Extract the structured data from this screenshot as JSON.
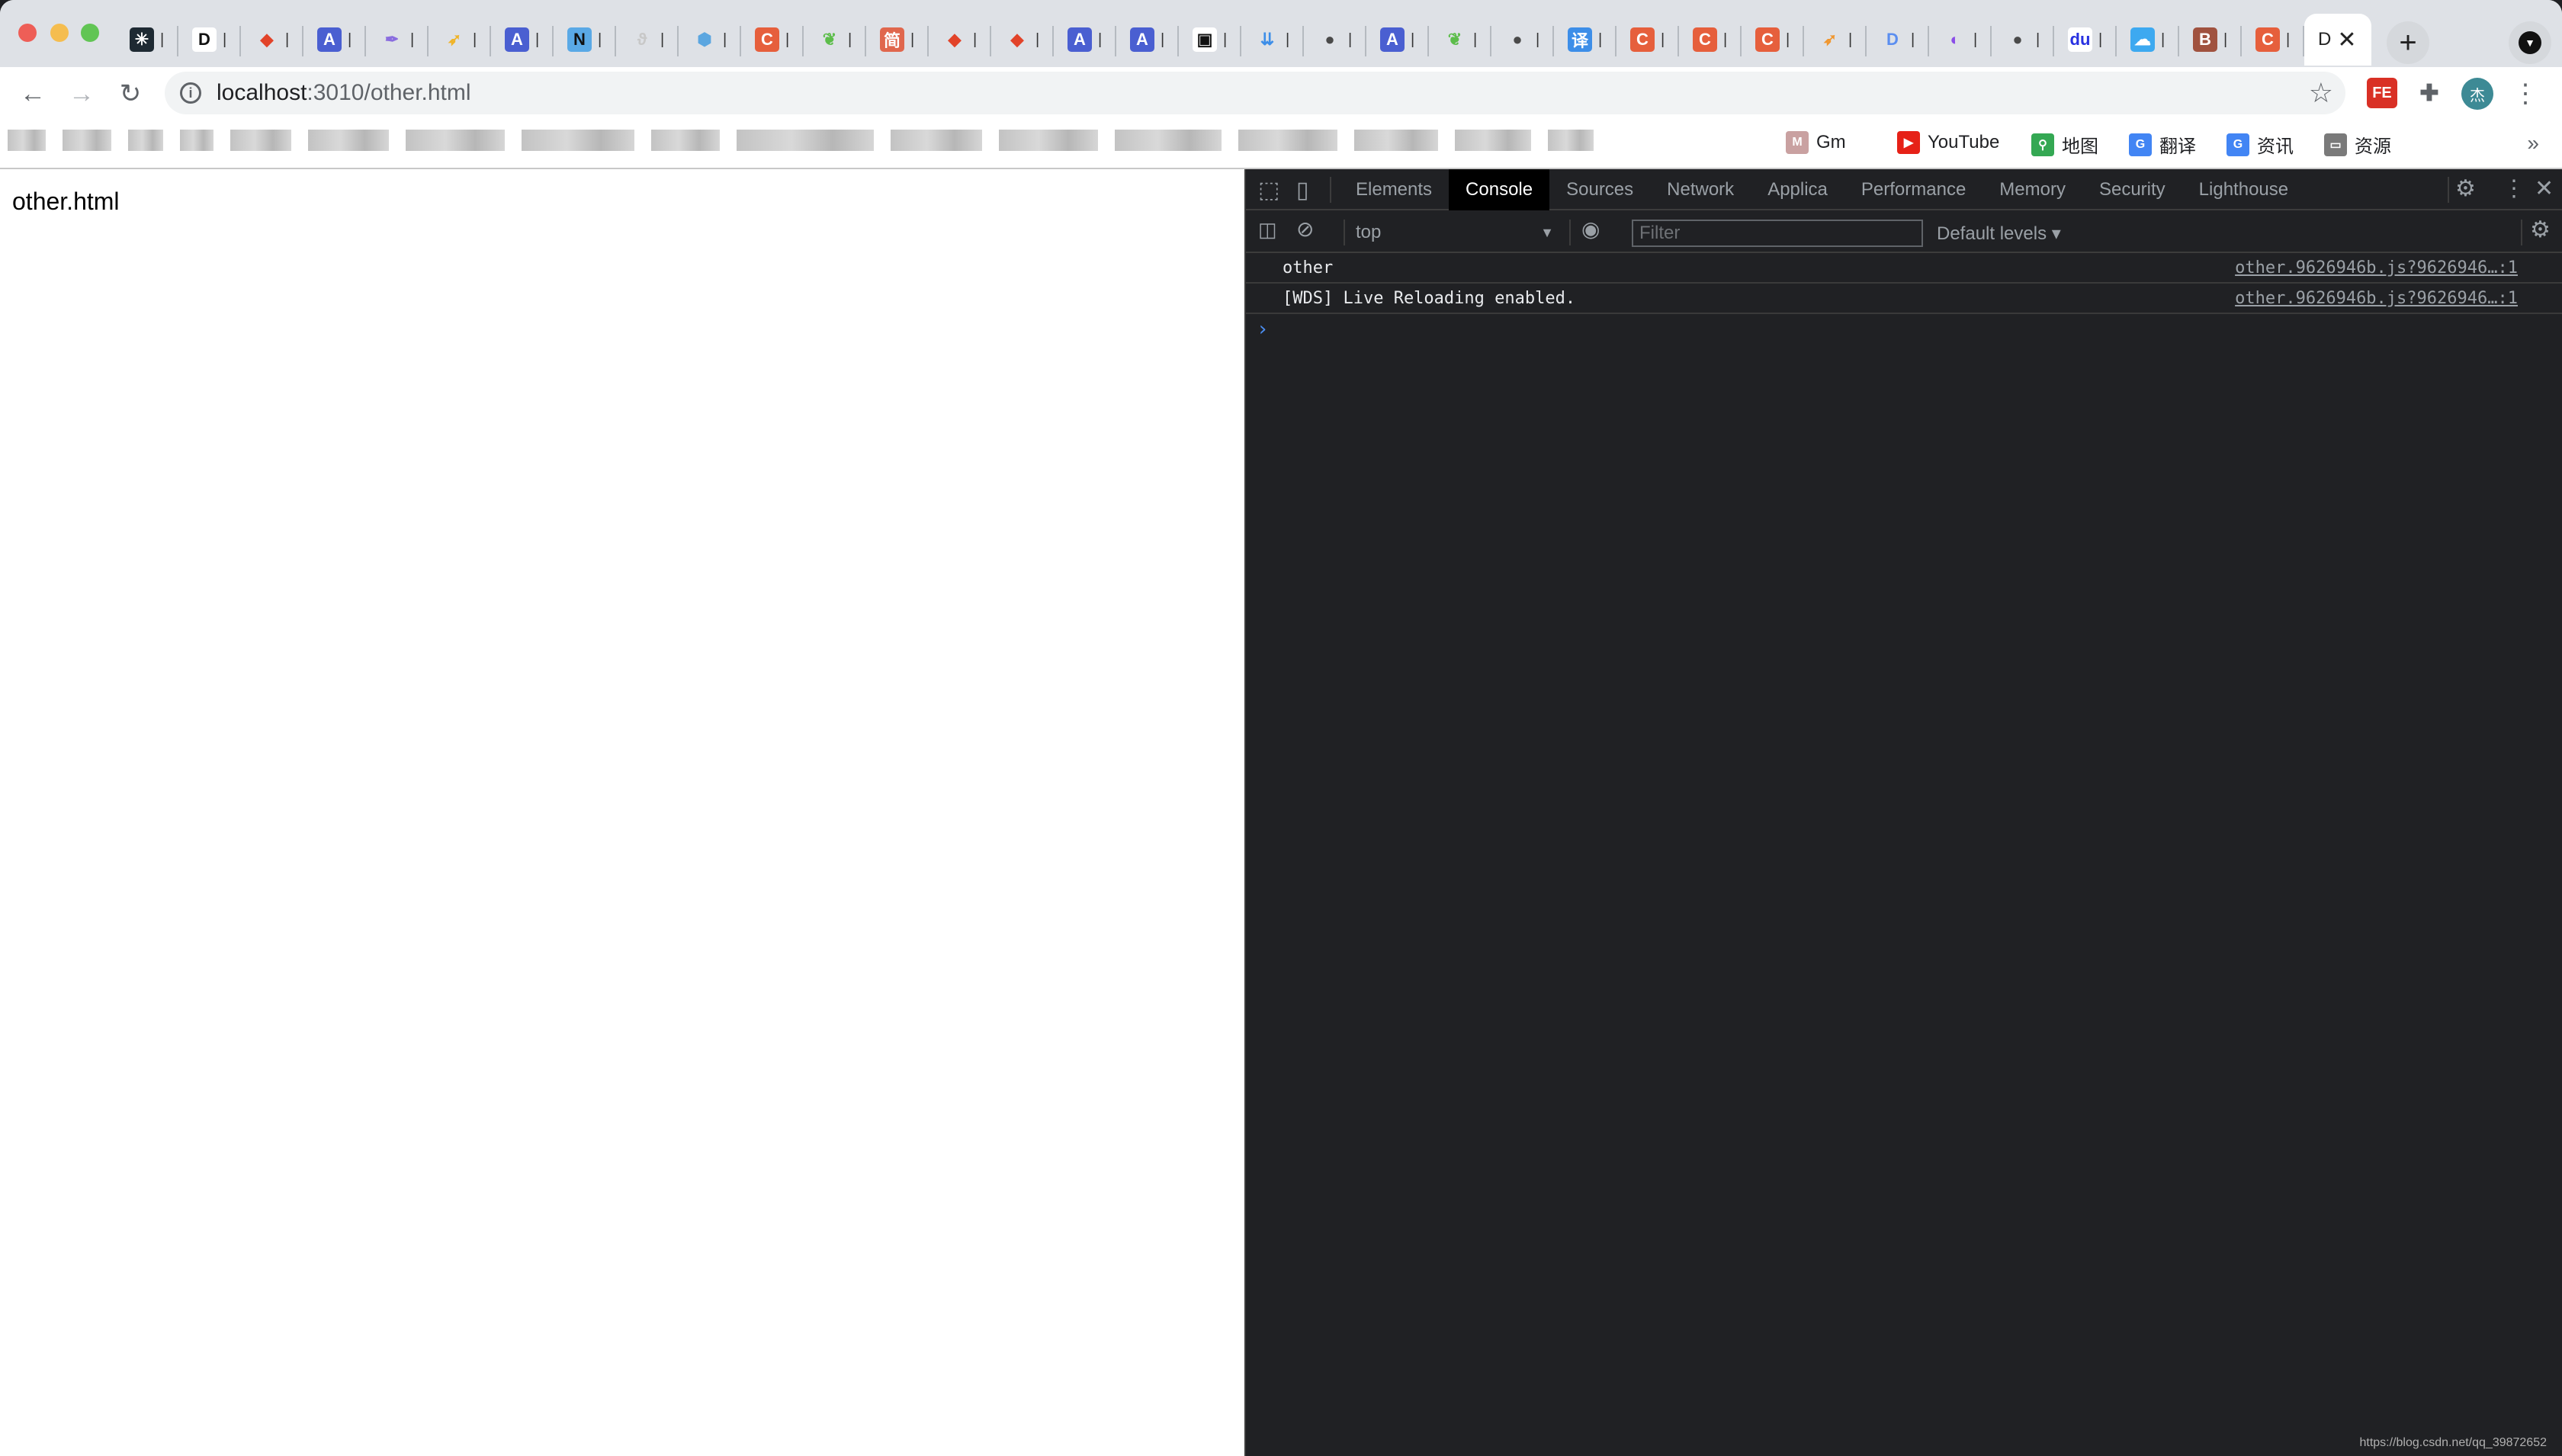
{
  "browser": {
    "tabs": [
      {
        "icon": "medusa-icon",
        "glyph": "✳",
        "bg": "#1e2a33",
        "fg": "#ffffff"
      },
      {
        "icon": "d-logo-icon",
        "glyph": "D",
        "bg": "#ffffff",
        "fg": "#111111"
      },
      {
        "icon": "gitlab-icon",
        "glyph": "◆",
        "bg": "transparent",
        "fg": "#e24329"
      },
      {
        "icon": "a-app-icon",
        "glyph": "A",
        "bg": "#4a5fd1",
        "fg": "#ffffff"
      },
      {
        "icon": "feather-icon",
        "glyph": "✒",
        "bg": "transparent",
        "fg": "#8a6ddf"
      },
      {
        "icon": "bird-icon",
        "glyph": "➶",
        "bg": "transparent",
        "fg": "#f0b429"
      },
      {
        "icon": "a-app-icon",
        "glyph": "A",
        "bg": "#4a5fd1",
        "fg": "#ffffff"
      },
      {
        "icon": "n-logo-icon",
        "glyph": "N",
        "bg": "#5aa9e6",
        "fg": "#111111"
      },
      {
        "icon": "vue-cli-icon",
        "glyph": "ϑ",
        "bg": "transparent",
        "fg": "#c8c8c8"
      },
      {
        "icon": "webpack-icon",
        "glyph": "⬢",
        "bg": "transparent",
        "fg": "#5ba6e0"
      },
      {
        "icon": "csdn-icon",
        "glyph": "C",
        "bg": "#e65f3c",
        "fg": "#ffffff"
      },
      {
        "icon": "green-leaf-icon",
        "glyph": "❦",
        "bg": "transparent",
        "fg": "#5cbd4a"
      },
      {
        "icon": "jianshu-icon",
        "glyph": "简",
        "bg": "#e0674d",
        "fg": "#ffffff"
      },
      {
        "icon": "gitlab-icon",
        "glyph": "◆",
        "bg": "transparent",
        "fg": "#e24329"
      },
      {
        "icon": "gitlab-icon",
        "glyph": "◆",
        "bg": "transparent",
        "fg": "#e24329"
      },
      {
        "icon": "a-app-icon",
        "glyph": "A",
        "bg": "#4a5fd1",
        "fg": "#ffffff"
      },
      {
        "icon": "a-app-icon",
        "glyph": "A",
        "bg": "#4a5fd1",
        "fg": "#ffffff"
      },
      {
        "icon": "folder-icon",
        "glyph": "▣",
        "bg": "#ffffff",
        "fg": "#111111"
      },
      {
        "icon": "download-chevrons-icon",
        "glyph": "⇊",
        "bg": "transparent",
        "fg": "#3d8ee8"
      },
      {
        "icon": "globe-icon",
        "glyph": "●",
        "bg": "transparent",
        "fg": "#4a4a4a"
      },
      {
        "icon": "a-app-icon",
        "glyph": "A",
        "bg": "#4a5fd1",
        "fg": "#ffffff"
      },
      {
        "icon": "green-leaf-icon",
        "glyph": "❦",
        "bg": "transparent",
        "fg": "#5cbd4a"
      },
      {
        "icon": "globe-icon",
        "glyph": "●",
        "bg": "transparent",
        "fg": "#4a4a4a"
      },
      {
        "icon": "translate-icon",
        "glyph": "译",
        "bg": "#3d8ee8",
        "fg": "#ffffff"
      },
      {
        "icon": "csdn-icon",
        "glyph": "C",
        "bg": "#e65f3c",
        "fg": "#ffffff"
      },
      {
        "icon": "csdn-icon",
        "glyph": "C",
        "bg": "#e65f3c",
        "fg": "#ffffff"
      },
      {
        "icon": "csdn-icon",
        "glyph": "C",
        "bg": "#e65f3c",
        "fg": "#ffffff"
      },
      {
        "icon": "orange-bird-icon",
        "glyph": "➶",
        "bg": "transparent",
        "fg": "#f0962e"
      },
      {
        "icon": "d-circle-icon",
        "glyph": "D",
        "bg": "transparent",
        "fg": "#5b8ef0"
      },
      {
        "icon": "purple-circle-icon",
        "glyph": "◐",
        "bg": "transparent",
        "fg": "#8a4de8"
      },
      {
        "icon": "globe-icon",
        "glyph": "●",
        "bg": "transparent",
        "fg": "#4a4a4a"
      },
      {
        "icon": "baidu-icon",
        "glyph": "du",
        "bg": "#ffffff",
        "fg": "#2932e1"
      },
      {
        "icon": "cloud-icon",
        "glyph": "☁",
        "bg": "#3da9f0",
        "fg": "#ffffff"
      },
      {
        "icon": "b-logo-icon",
        "glyph": "B",
        "bg": "#a0523f",
        "fg": "#ffffff"
      },
      {
        "icon": "csdn-icon",
        "glyph": "C",
        "bg": "#e65f3c",
        "fg": "#ffffff"
      }
    ],
    "active_tab": {
      "title_fragment": "D",
      "close_glyph": "✕"
    },
    "new_tab_glyph": "+",
    "tab_search_glyph": "▼",
    "nav": {
      "back": "←",
      "forward": "→",
      "reload": "↻"
    },
    "url_host": "localhost",
    "url_rest": ":3010/other.html",
    "info_glyph": "i",
    "star_glyph": "☆",
    "extensions": [
      {
        "name": "fe-helper-extension",
        "label": "FE",
        "bg": "#d93025"
      },
      {
        "name": "extensions-puzzle-icon",
        "label": "✚",
        "bg": "transparent"
      }
    ],
    "avatar_label": "杰",
    "menu_glyph": "⋮",
    "bookmarks": [
      {
        "label": "Gm",
        "icon": "gmail-icon",
        "glyph": "M",
        "bg": "#c9a1a1"
      },
      {
        "label": "YouTube",
        "icon": "youtube-icon",
        "glyph": "▶",
        "bg": "#e62117"
      },
      {
        "label": "地图",
        "icon": "maps-pin-icon",
        "glyph": "⚲",
        "bg": "#34a853"
      },
      {
        "label": "翻译",
        "icon": "google-translate-icon",
        "glyph": "G",
        "bg": "#4285f4"
      },
      {
        "label": "资讯",
        "icon": "google-news-icon",
        "glyph": "G",
        "bg": "#4285f4"
      },
      {
        "label": "资源",
        "icon": "folder-icon",
        "glyph": "▭",
        "bg": "#7a7a7a"
      }
    ],
    "bookmarks_more": "»"
  },
  "page": {
    "text": "other.html"
  },
  "devtools": {
    "tabs": [
      "Elements",
      "Console",
      "Sources",
      "Network",
      "Applica",
      "Performance",
      "Memory",
      "Security",
      "Lighthouse"
    ],
    "active_tab": "Console",
    "context": "top",
    "filter_placeholder": "Filter",
    "levels": "Default levels ▾",
    "messages": [
      {
        "text": "other",
        "source": "other.9626946b.js?9626946…:1"
      },
      {
        "text": "[WDS] Live Reloading enabled.",
        "source": "other.9626946b.js?9626946…:1"
      }
    ],
    "prompt": "›"
  },
  "watermark": "https://blog.csdn.net/qq_39872652"
}
